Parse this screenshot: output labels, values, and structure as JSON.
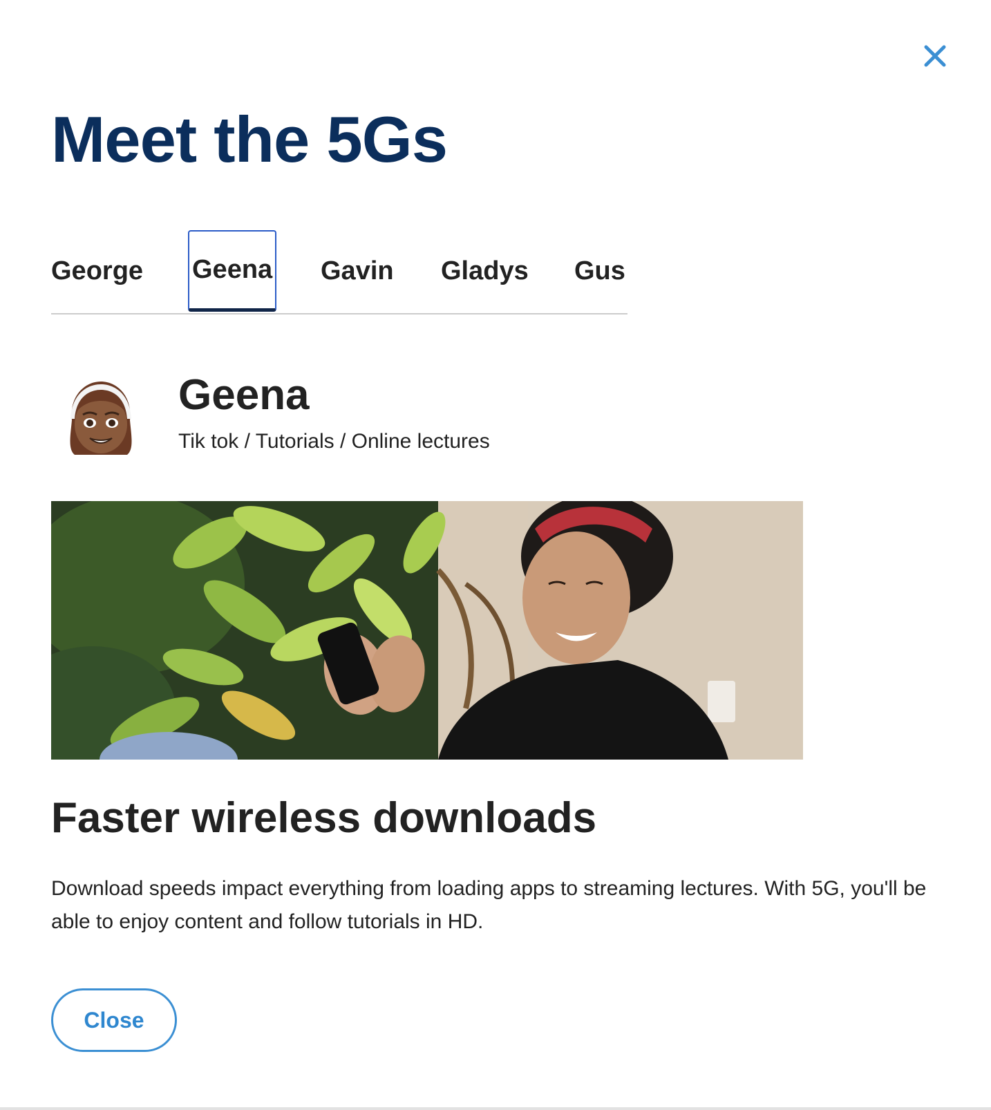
{
  "modal": {
    "title": "Meet the 5Gs",
    "close_icon": "close-icon",
    "accent_color": "#3b8fd3",
    "title_color": "#0b2e5c"
  },
  "tabs": [
    {
      "label": "George",
      "active": false
    },
    {
      "label": "Geena",
      "active": true
    },
    {
      "label": "Gavin",
      "active": false
    },
    {
      "label": "Gladys",
      "active": false
    },
    {
      "label": "Gus",
      "active": false
    }
  ],
  "profile": {
    "avatar_icon": "girl-emoji-avatar",
    "name": "Geena",
    "interests": "Tik tok / Tutorials / Online lectures"
  },
  "feature": {
    "heading": "Faster wireless downloads",
    "description": "Download speeds impact everything from loading apps to streaming lectures. With 5G, you'll be able to enjoy content and follow tutorials in HD."
  },
  "footer": {
    "close_label": "Close"
  }
}
